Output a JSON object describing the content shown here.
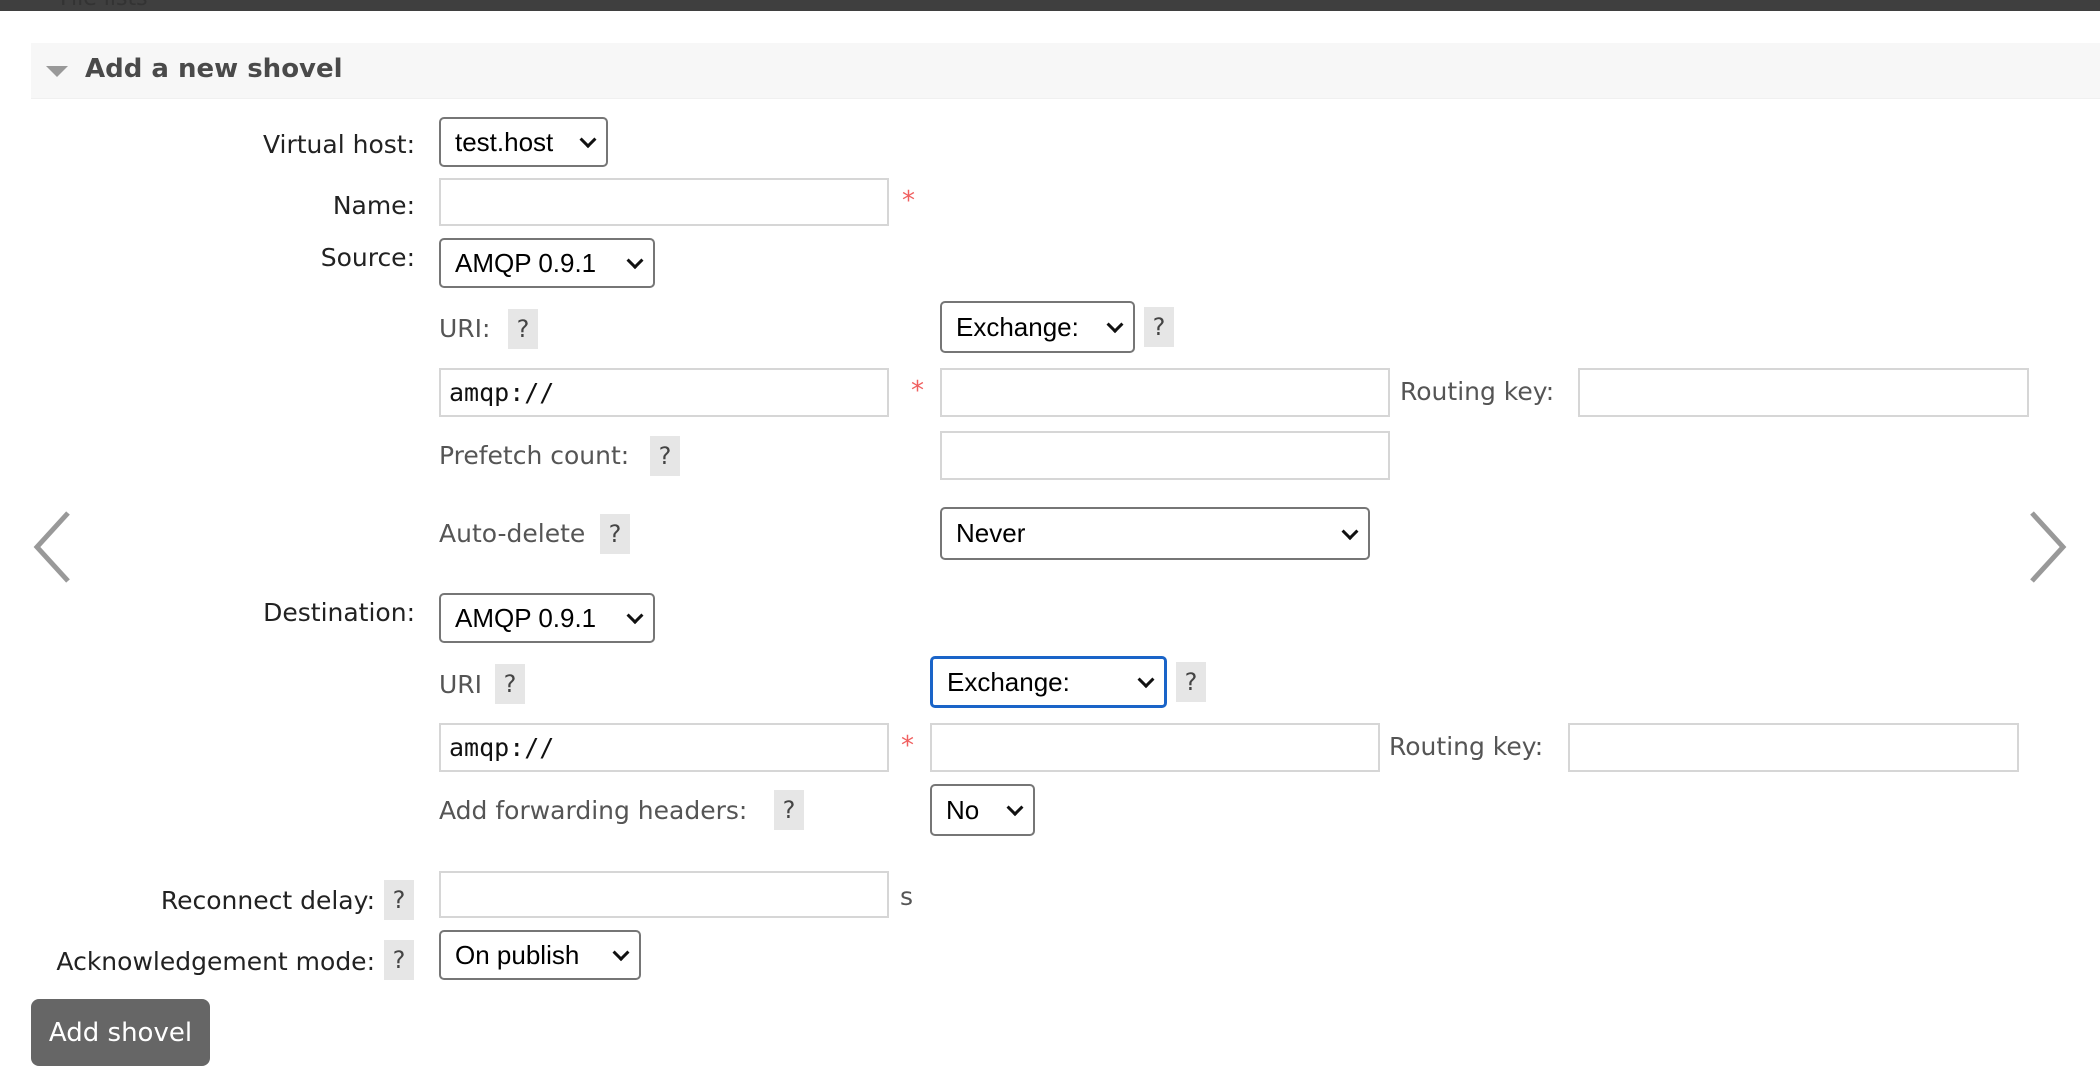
{
  "topbar": {
    "partial_text": "File lists"
  },
  "section": {
    "title": "Add a new shovel",
    "expanded": true
  },
  "form": {
    "vhost": {
      "label": "Virtual host:",
      "value": "test.host"
    },
    "name": {
      "label": "Name:",
      "value": "",
      "required_marker": "*"
    },
    "source": {
      "label": "Source:",
      "protocol": "AMQP 0.9.1",
      "uri_label": "URI:",
      "uri_value": "amqp://",
      "uri_required_marker": "*",
      "type_select": "Exchange:",
      "exchange_value": "",
      "routing_key_label": "Routing key:",
      "routing_key_value": "",
      "prefetch_label": "Prefetch count:",
      "prefetch_value": "",
      "auto_delete_label": "Auto-delete",
      "auto_delete_value": "Never"
    },
    "destination": {
      "label": "Destination:",
      "protocol": "AMQP 0.9.1",
      "uri_label": "URI",
      "uri_value": "amqp://",
      "uri_required_marker": "*",
      "type_select": "Exchange:",
      "exchange_value": "",
      "routing_key_label": "Routing key:",
      "routing_key_value": "",
      "fwd_headers_label": "Add forwarding headers:",
      "fwd_headers_value": "No"
    },
    "reconnect": {
      "label": "Reconnect delay:",
      "value": "",
      "unit": "s"
    },
    "ack_mode": {
      "label": "Acknowledgement mode:",
      "value": "On publish"
    },
    "help_glyph": "?",
    "submit_label": "Add shovel"
  },
  "nav": {
    "prev_icon": "chevron-left",
    "next_icon": "chevron-right"
  },
  "colors": {
    "focus": "#1a64c8",
    "required": "#f06060",
    "button": "#666666",
    "header_bg": "#f7f7f7"
  }
}
